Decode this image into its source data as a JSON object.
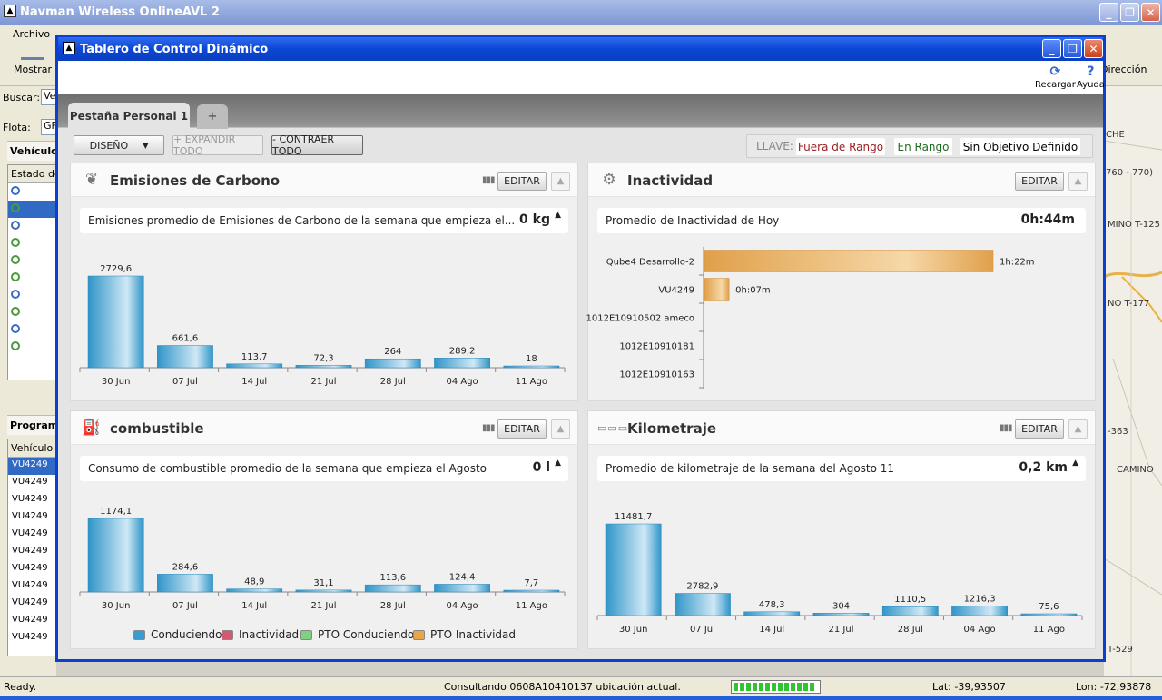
{
  "app": {
    "title": "Navman Wireless OnlineAVL 2",
    "menu_first": "Archivo",
    "show_label": "Mostrar",
    "direction_label": "Dirección",
    "search_label": "Buscar:",
    "search_value": "Ve",
    "fleet_label": "Flota:",
    "fleet_value": "GF",
    "vehicles_header": "Vehículos",
    "state_col": "Estado de",
    "programs_header": "Program",
    "vehicle_col": "Vehículo",
    "vehicle_rows": [
      "VU4249",
      "VU4249",
      "VU4249",
      "VU4249",
      "VU4249",
      "VU4249",
      "VU4249",
      "VU4249",
      "VU4249",
      "VU4249",
      "VU4249"
    ]
  },
  "map": {
    "labels": [
      "CHE",
      "760 - 770)",
      "MINO T-125",
      "NO T-177",
      "-363",
      "CAMINO",
      "T-529"
    ]
  },
  "status": {
    "ready": "Ready.",
    "message": "Consultando 0608A10410137 ubicación actual.",
    "lat": "Lat: -39,93507",
    "lon": "Lon: -72,93878"
  },
  "dialog": {
    "title": "Tablero de Control Dinámico",
    "reload": "Recargar",
    "help": "Ayuda",
    "tab_personal": "Pestaña Personal 1",
    "tab_add": "+",
    "design": "DISEÑO",
    "expand_all": "+ EXPANDIR TODO",
    "collapse_all": "- CONTRAER TODO",
    "key_label": "LLAVE:",
    "key_out": "Fuera de Rango",
    "key_in": "En Rango",
    "key_none": "Sin Objetivo Definido",
    "edit": "EDITAR"
  },
  "colors": {
    "out_of_range": "#9b1c1c",
    "in_range": "#1e6b1e",
    "bar_blue": "#2f95c8",
    "bar_orange": "#e0a04a"
  },
  "panels": {
    "carbon": {
      "title": "Emisiones de Carbono",
      "summary": "Emisiones promedio de Emisiones de Carbono de la semana que empieza el...",
      "value": "0 kg"
    },
    "idle": {
      "title": "Inactividad",
      "summary": "Promedio de Inactividad de Hoy",
      "value": "0h:44m"
    },
    "fuel": {
      "title": "combustible",
      "summary": "Consumo de combustible promedio de la semana que empieza el Agosto",
      "value": "0 l"
    },
    "mileage": {
      "title": "Kilometraje",
      "summary": "Promedio de kilometraje de la semana del Agosto 11",
      "value": "0,2 km"
    }
  },
  "legend": {
    "driving": "Conduciendo",
    "idle": "Inactividad",
    "pto_driving": "PTO Conduciendo",
    "pto_idle": "PTO Inactividad"
  },
  "chart_data": [
    {
      "type": "bar",
      "id": "carbon",
      "categories": [
        "30 Jun",
        "07 Jul",
        "14 Jul",
        "21 Jul",
        "28 Jul",
        "04 Ago",
        "11 Ago"
      ],
      "values": [
        2729.6,
        661.6,
        113.7,
        72.3,
        264,
        289.2,
        18
      ],
      "labels": [
        "2729,6",
        "661,6",
        "113,7",
        "72,3",
        "264",
        "289,2",
        "18"
      ]
    },
    {
      "type": "bar",
      "id": "idle",
      "orientation": "horizontal",
      "categories": [
        "Qube4 Desarrollo-2",
        "VU4249",
        "1012E10910502 ameco",
        "1012E10910181",
        "1012E10910163"
      ],
      "values_minutes": [
        82,
        7,
        0,
        0,
        0
      ],
      "labels": [
        "1h:22m",
        "0h:07m",
        "",
        "",
        ""
      ]
    },
    {
      "type": "bar",
      "id": "fuel",
      "categories": [
        "30 Jun",
        "07 Jul",
        "14 Jul",
        "21 Jul",
        "28 Jul",
        "04 Ago",
        "11 Ago"
      ],
      "values": [
        1174.1,
        284.6,
        48.9,
        31.1,
        113.6,
        124.4,
        7.7
      ],
      "labels": [
        "1174,1",
        "284,6",
        "48,9",
        "31,1",
        "113,6",
        "124,4",
        "7,7"
      ]
    },
    {
      "type": "bar",
      "id": "mileage",
      "categories": [
        "30 Jun",
        "07 Jul",
        "14 Jul",
        "21 Jul",
        "28 Jul",
        "04 Ago",
        "11 Ago"
      ],
      "values": [
        11481.7,
        2782.9,
        478.3,
        304,
        1110.5,
        1216.3,
        75.6
      ],
      "labels": [
        "11481,7",
        "2782,9",
        "478,3",
        "304",
        "1110,5",
        "1216,3",
        "75,6"
      ]
    }
  ]
}
